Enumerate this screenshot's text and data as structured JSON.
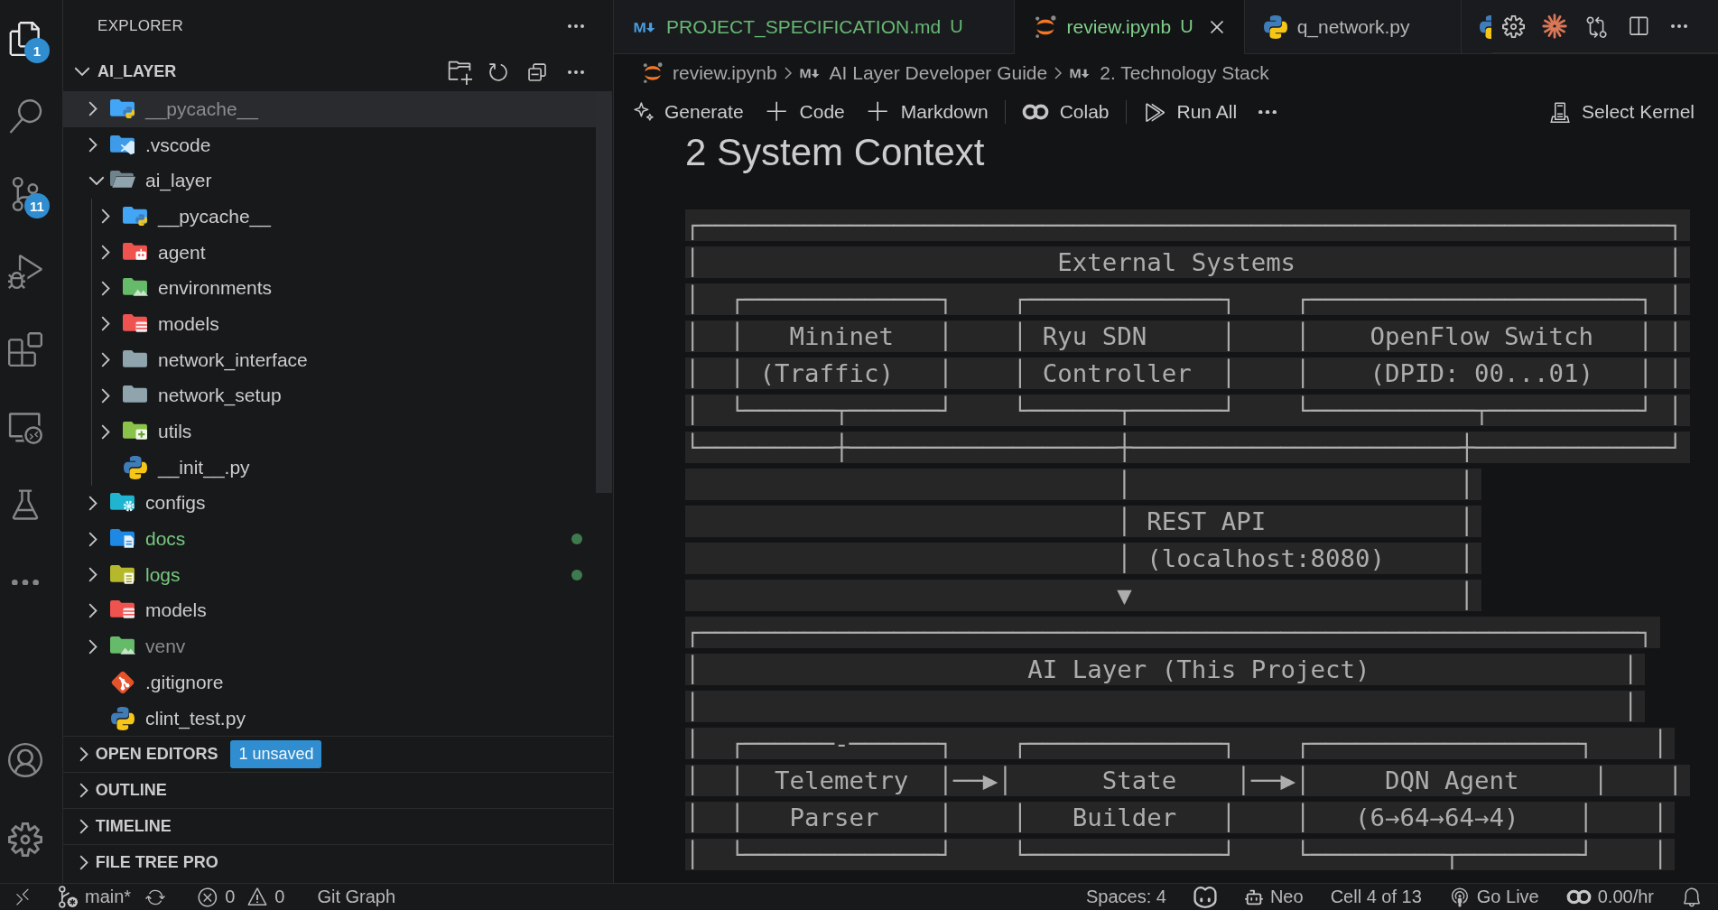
{
  "activity_bar": {
    "items": [
      {
        "kind": "explorer",
        "selected": true,
        "badge": "1"
      },
      {
        "kind": "search",
        "selected": false
      },
      {
        "kind": "source-control",
        "selected": false,
        "badge": "11"
      },
      {
        "kind": "run-debug",
        "selected": false
      },
      {
        "kind": "extensions",
        "selected": false
      },
      {
        "kind": "remote-explorer",
        "selected": false
      },
      {
        "kind": "testing",
        "selected": false
      },
      {
        "kind": "more",
        "selected": false
      }
    ],
    "bottom": [
      {
        "kind": "account"
      },
      {
        "kind": "settings"
      }
    ]
  },
  "sidebar": {
    "title": "EXPLORER",
    "folder": {
      "name": "AI_LAYER",
      "expanded": true
    },
    "tree": [
      {
        "name": "__pycache__",
        "kind": "folder-python",
        "expanded": false,
        "selected": true,
        "ignored": true,
        "untracked": false
      },
      {
        "name": ".vscode",
        "kind": "folder-vscode",
        "expanded": false,
        "selected": false,
        "ignored": false,
        "untracked": false
      },
      {
        "name": "ai_layer",
        "kind": "folder",
        "expanded": true,
        "selected": false,
        "ignored": false,
        "untracked": false,
        "children": [
          {
            "name": "__pycache__",
            "kind": "folder-python",
            "expanded": false,
            "selected": false,
            "ignored": false,
            "untracked": false
          },
          {
            "name": "agent",
            "kind": "folder-robot",
            "expanded": false,
            "selected": false,
            "ignored": false,
            "untracked": false
          },
          {
            "name": "environments",
            "kind": "folder-environment",
            "expanded": false,
            "selected": false,
            "ignored": false,
            "untracked": false
          },
          {
            "name": "models",
            "kind": "folder-database",
            "expanded": false,
            "selected": false,
            "ignored": false,
            "untracked": false
          },
          {
            "name": "network_interface",
            "kind": "folder",
            "expanded": false,
            "selected": false,
            "ignored": false,
            "untracked": false
          },
          {
            "name": "network_setup",
            "kind": "folder",
            "expanded": false,
            "selected": false,
            "ignored": false,
            "untracked": false
          },
          {
            "name": "utils",
            "kind": "folder-utils",
            "expanded": false,
            "selected": false,
            "ignored": false,
            "untracked": false
          },
          {
            "name": "__init__.py",
            "kind": "file-python",
            "selected": false,
            "ignored": false,
            "untracked": false
          }
        ]
      },
      {
        "name": "configs",
        "kind": "folder-config",
        "expanded": false,
        "selected": false,
        "ignored": false,
        "untracked": false
      },
      {
        "name": "docs",
        "kind": "folder-docs",
        "expanded": false,
        "selected": false,
        "ignored": false,
        "untracked": true
      },
      {
        "name": "logs",
        "kind": "folder-logs",
        "expanded": false,
        "selected": false,
        "ignored": false,
        "untracked": true
      },
      {
        "name": "models",
        "kind": "folder-database",
        "expanded": false,
        "selected": false,
        "ignored": false,
        "untracked": false
      },
      {
        "name": "venv",
        "kind": "folder-environment",
        "expanded": false,
        "selected": false,
        "ignored": true,
        "untracked": false
      },
      {
        "name": ".gitignore",
        "kind": "file-git",
        "selected": false,
        "ignored": false,
        "untracked": false
      },
      {
        "name": "clint_test.py",
        "kind": "file-python",
        "selected": false,
        "ignored": false,
        "untracked": false
      }
    ],
    "sections": [
      {
        "title": "OPEN EDITORS",
        "expanded": false,
        "badge": "1 unsaved"
      },
      {
        "title": "OUTLINE",
        "expanded": false
      },
      {
        "title": "TIMELINE",
        "expanded": false
      },
      {
        "title": "FILE TREE PRO",
        "expanded": false
      }
    ]
  },
  "editor": {
    "tabs": [
      {
        "label": "PROJECT_SPECIFICATION.md",
        "kind": "markdown",
        "status": "U",
        "untracked": true,
        "selected": false
      },
      {
        "label": "review.ipynb",
        "kind": "notebook",
        "status": "U",
        "untracked": true,
        "selected": true
      },
      {
        "label": "q_network.py",
        "kind": "python",
        "untracked": false,
        "selected": false
      },
      {
        "kind": "python",
        "selected": false
      }
    ],
    "breadcrumb": [
      {
        "kind": "notebook",
        "label": "review.ipynb"
      },
      {
        "kind": "markdown",
        "label": "AI Layer Developer Guide"
      },
      {
        "kind": "markdown",
        "label": "2. Technology Stack"
      }
    ],
    "toolbar": {
      "items": [
        {
          "kind": "generate",
          "label": "Generate"
        },
        {
          "kind": "add",
          "label": "Code"
        },
        {
          "kind": "add",
          "label": "Markdown"
        },
        {
          "kind": "separator"
        },
        {
          "kind": "colab",
          "label": "Colab"
        },
        {
          "kind": "separator"
        },
        {
          "kind": "run-all",
          "label": "Run All"
        },
        {
          "kind": "more"
        }
      ],
      "kernel": {
        "kind": "kernel",
        "label": "Select Kernel"
      }
    },
    "notebook": {
      "heading": "2 System Context",
      "code_lines": [
        "┌─────────────────────────────────────────────────────────────────┐",
        "│                        External Systems                         │",
        "│  ┌─────────────┐    ┌─────────────┐    ┌──────────────────────┐ │",
        "│  │   Mininet   │    │ Ryu SDN     │    │    OpenFlow Switch   │ │",
        "│  │ (Traffic)   │    │ Controller  │    │    (DPID: 00...01)   │ │",
        "│  └──────┬──────┘    └──────┬──────┘    └───────────┬──────────┘ │",
        "└─────────┼──────────────────┼──────────────────────┼─────────────┘",
        "                             │                      │",
        "                             │ REST API             │",
        "                             │ (localhost:8080)     │",
        "                             ▼                      │",
        "┌───────────────────────────────────────────────────────────────┐",
        "│                      AI Layer (This Project)                 │",
        "│                                                              │",
        "│  ┌──────-──────┐    ┌─────────────┐    ┌──────────────────┐    │",
        "│  │  Telemetry  │──▶│      State    │──▶│     DQN Agent     │    │",
        "│  │   Parser    │    │   Builder   │    │   (6→64→64→4)    │    │",
        "│  └─────────────┘    └─────────────┘    └─────────┬────────┘    │"
      ]
    }
  },
  "status_bar": {
    "left": [
      {
        "kind": "remote"
      },
      {
        "kind": "branch",
        "label": "main*"
      },
      {
        "kind": "sync"
      },
      {
        "kind": "problems",
        "errors": "0",
        "warnings": "0"
      },
      {
        "kind": "text",
        "label": "Git Graph"
      }
    ],
    "right": [
      {
        "kind": "text",
        "label": "Spaces: 4"
      },
      {
        "kind": "copilot"
      },
      {
        "kind": "agent",
        "label": "Neo"
      },
      {
        "kind": "text",
        "label": "Cell 4 of 13"
      },
      {
        "kind": "live",
        "label": "Go Live"
      },
      {
        "kind": "colab",
        "label": "0.00/hr"
      },
      {
        "kind": "notifications"
      }
    ]
  }
}
